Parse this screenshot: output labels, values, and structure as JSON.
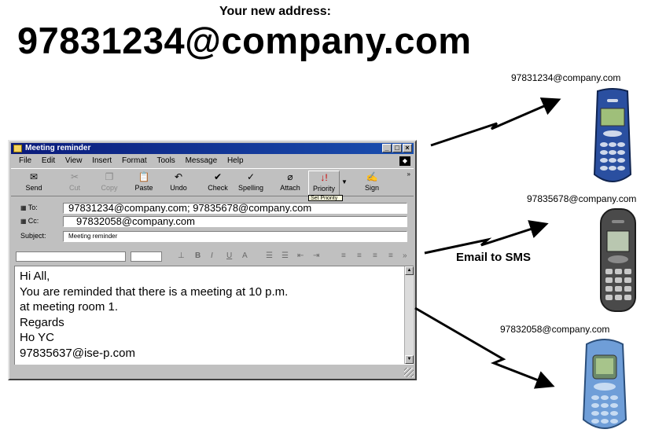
{
  "header": {
    "label": "Your new address:",
    "address": "97831234@company.com"
  },
  "window": {
    "title": "Meeting reminder",
    "menu": [
      "File",
      "Edit",
      "View",
      "Insert",
      "Format",
      "Tools",
      "Message",
      "Help"
    ],
    "toolbar": [
      "Send",
      "Cut",
      "Copy",
      "Paste",
      "Undo",
      "Check",
      "Spelling",
      "Attach",
      "Priority",
      "Sign"
    ],
    "priority_tip": "Set Priority",
    "to_label": "To:",
    "to_value": "97831234@company.com; 97835678@company.com",
    "cc_label": "Cc:",
    "cc_value": "97832058@company.com",
    "subject_label": "Subject:",
    "subject_value": "Meeting reminder",
    "body": "Hi All,\nYou are reminded that there is a meeting at 10 p.m.\nat meeting room 1.\nRegards\nHo YC\n97835637@ise-p.com"
  },
  "diagram": {
    "middle_label": "Email to SMS",
    "phone1_address": "97831234@company.com",
    "phone2_address": "97835678@company.com",
    "phone3_address": "97832058@company.com"
  },
  "colors": {
    "titlebar": "#0a1a7a",
    "arrow": "#000000",
    "phone1_body": "#2a4fa0",
    "phone2_body": "#4a4a4a",
    "phone3_body": "#6f9ed8"
  }
}
